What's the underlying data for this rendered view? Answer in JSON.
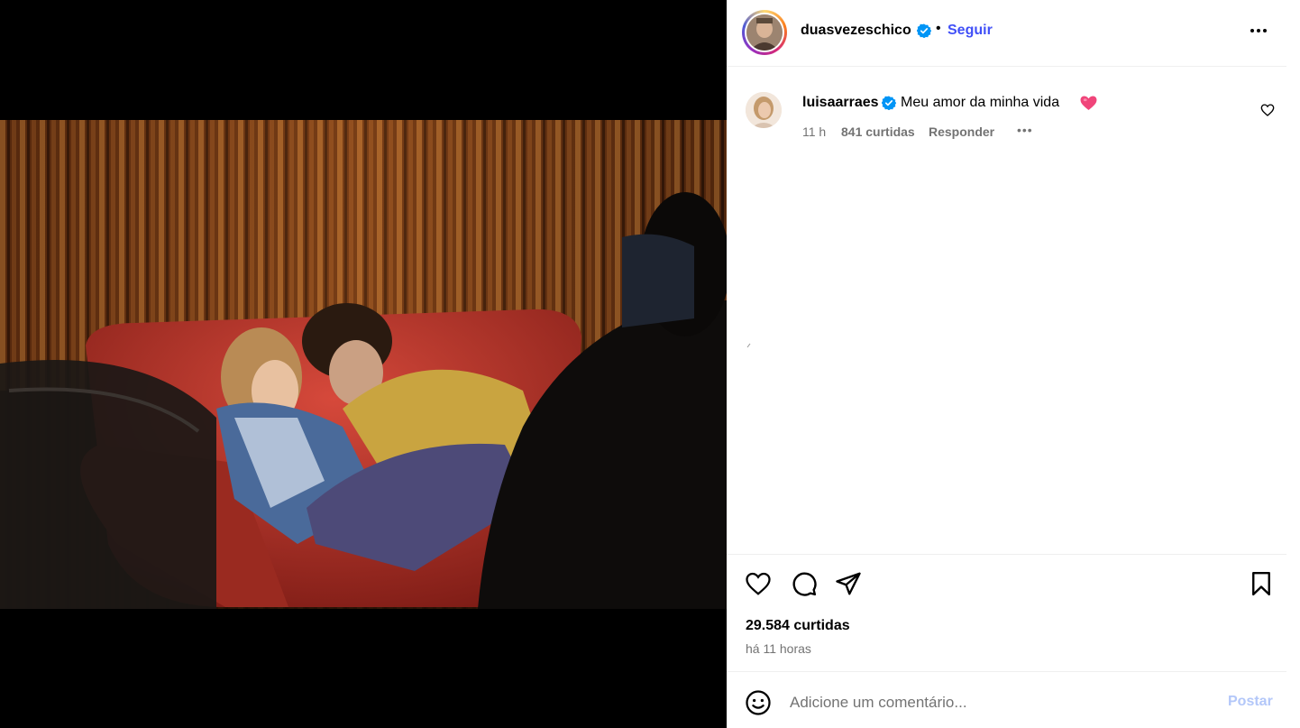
{
  "post": {
    "author": "duasvezeschico",
    "follow_label": "Seguir",
    "separator": "•",
    "likes": "29.584 curtidas",
    "time_ago": "há 11 horas"
  },
  "comments": [
    {
      "username": "luisaarraes",
      "text": "Meu amor da minha vida",
      "time": "11 h",
      "likes": "841 curtidas",
      "reply_label": "Responder",
      "more": "•••"
    }
  ],
  "composer": {
    "placeholder": "Adicione um comentário...",
    "post_label": "Postar"
  },
  "colors": {
    "accent": "#4150f7",
    "verified": "#0095f6",
    "post_disabled": "#b3c7f9",
    "meta_gray": "#737373",
    "heart_emoji": "#f0457a"
  },
  "icons": [
    "verified-badge-icon",
    "more-options-icon",
    "heart-icon",
    "comment-icon",
    "share-icon",
    "bookmark-icon",
    "emoji-icon",
    "pink-heart-emoji-icon"
  ]
}
